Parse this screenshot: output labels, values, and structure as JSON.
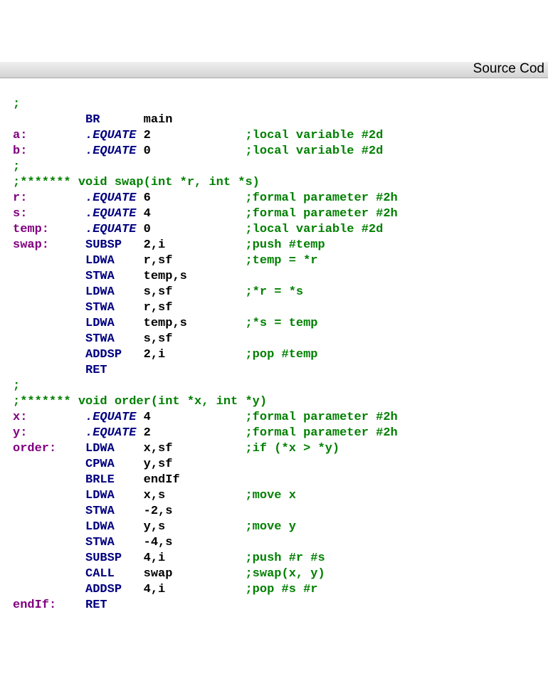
{
  "header": "Source Cod",
  "lines": [
    {
      "c": ";"
    },
    {
      "l": "",
      "m": "BR",
      "o": "main"
    },
    {
      "l": "a:",
      "p": ".EQUATE",
      "o": "2",
      "c": ";local variable #2d"
    },
    {
      "l": "b:",
      "p": ".EQUATE",
      "o": "0",
      "c": ";local variable #2d"
    },
    {
      "c": ";"
    },
    {
      "c": ";******* void swap(int *r, int *s)"
    },
    {
      "l": "r:",
      "p": ".EQUATE",
      "o": "6",
      "c": ";formal parameter #2h"
    },
    {
      "l": "s:",
      "p": ".EQUATE",
      "o": "4",
      "c": ";formal parameter #2h"
    },
    {
      "l": "temp:",
      "p": ".EQUATE",
      "o": "0",
      "c": ";local variable #2d"
    },
    {
      "l": "swap:",
      "m": "SUBSP",
      "o": "2,i",
      "c": ";push #temp"
    },
    {
      "l": "",
      "m": "LDWA",
      "o": "r,sf",
      "c": ";temp = *r"
    },
    {
      "l": "",
      "m": "STWA",
      "o": "temp,s"
    },
    {
      "l": "",
      "m": "LDWA",
      "o": "s,sf",
      "c": ";*r = *s"
    },
    {
      "l": "",
      "m": "STWA",
      "o": "r,sf"
    },
    {
      "l": "",
      "m": "LDWA",
      "o": "temp,s",
      "c": ";*s = temp"
    },
    {
      "l": "",
      "m": "STWA",
      "o": "s,sf"
    },
    {
      "l": "",
      "m": "ADDSP",
      "o": "2,i",
      "c": ";pop #temp"
    },
    {
      "l": "",
      "m": "RET"
    },
    {
      "c": ";"
    },
    {
      "c": ";******* void order(int *x, int *y)"
    },
    {
      "l": "x:",
      "p": ".EQUATE",
      "o": "4",
      "c": ";formal parameter #2h"
    },
    {
      "l": "y:",
      "p": ".EQUATE",
      "o": "2",
      "c": ";formal parameter #2h"
    },
    {
      "l": "order:",
      "m": "LDWA",
      "o": "x,sf",
      "c": ";if (*x > *y)"
    },
    {
      "l": "",
      "m": "CPWA",
      "o": "y,sf"
    },
    {
      "l": "",
      "m": "BRLE",
      "o": "endIf"
    },
    {
      "l": "",
      "m": "LDWA",
      "o": "x,s",
      "c": ";move x"
    },
    {
      "l": "",
      "m": "STWA",
      "o": "-2,s"
    },
    {
      "l": "",
      "m": "LDWA",
      "o": "y,s",
      "c": ";move y"
    },
    {
      "l": "",
      "m": "STWA",
      "o": "-4,s"
    },
    {
      "l": "",
      "m": "SUBSP",
      "o": "4,i",
      "c": ";push #r #s"
    },
    {
      "l": "",
      "m": "CALL",
      "o": "swap",
      "c": ";swap(x, y)"
    },
    {
      "l": "",
      "m": "ADDSP",
      "o": "4,i",
      "c": ";pop #s #r"
    },
    {
      "l": "endIf:",
      "m": "RET"
    }
  ]
}
